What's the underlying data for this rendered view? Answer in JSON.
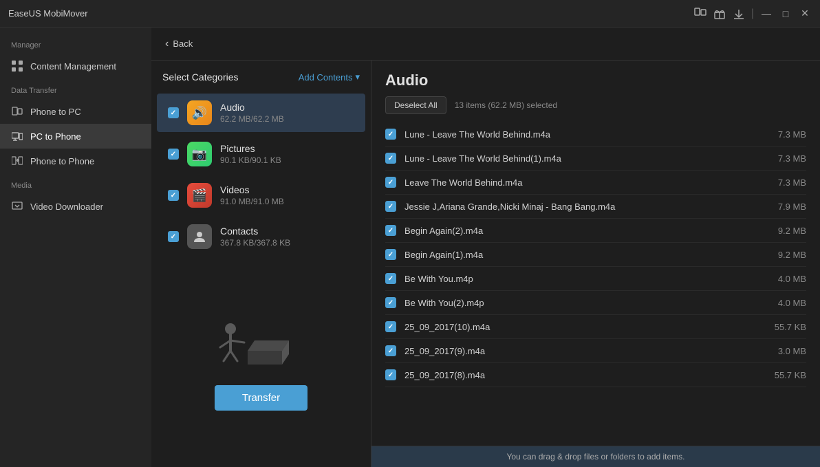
{
  "app": {
    "title": "EaseUS MobiMover"
  },
  "titlebar": {
    "icons": [
      "device-icon",
      "gift-icon",
      "download-icon"
    ],
    "controls": [
      "minimize",
      "maximize",
      "close"
    ]
  },
  "sidebar": {
    "manager_label": "Manager",
    "content_management_label": "Content Management",
    "data_transfer_label": "Data Transfer",
    "items": [
      {
        "id": "content-management",
        "label": "Content Management",
        "icon": "⊞"
      },
      {
        "id": "phone-to-pc",
        "label": "Phone to PC",
        "icon": "📱"
      },
      {
        "id": "pc-to-phone",
        "label": "PC to Phone",
        "icon": "💻",
        "active": true
      },
      {
        "id": "phone-to-phone",
        "label": "Phone to Phone",
        "icon": "📲"
      }
    ],
    "media_label": "Media",
    "media_items": [
      {
        "id": "video-downloader",
        "label": "Video Downloader",
        "icon": "▼"
      }
    ]
  },
  "back_button": "Back",
  "select_categories": {
    "title": "Select Categories",
    "add_contents_label": "Add Contents",
    "items": [
      {
        "id": "audio",
        "name": "Audio",
        "size": "62.2 MB/62.2 MB",
        "type": "audio",
        "checked": true
      },
      {
        "id": "pictures",
        "name": "Pictures",
        "size": "90.1 KB/90.1 KB",
        "type": "pictures",
        "checked": true
      },
      {
        "id": "videos",
        "name": "Videos",
        "size": "91.0 MB/91.0 MB",
        "type": "videos",
        "checked": true
      },
      {
        "id": "contacts",
        "name": "Contacts",
        "size": "367.8 KB/367.8 KB",
        "type": "contacts",
        "checked": true
      }
    ]
  },
  "transfer_button": "Transfer",
  "files_panel": {
    "title": "Audio",
    "deselect_all": "Deselect All",
    "selection_info": "13 items (62.2 MB) selected",
    "files": [
      {
        "name": "Lune - Leave The World Behind.m4a",
        "size": "7.3 MB",
        "checked": true
      },
      {
        "name": "Lune - Leave The World Behind(1).m4a",
        "size": "7.3 MB",
        "checked": true
      },
      {
        "name": "Leave The World Behind.m4a",
        "size": "7.3 MB",
        "checked": true
      },
      {
        "name": "Jessie J,Ariana Grande,Nicki Minaj - Bang Bang.m4a",
        "size": "7.9 MB",
        "checked": true
      },
      {
        "name": "Begin Again(2).m4a",
        "size": "9.2 MB",
        "checked": true
      },
      {
        "name": "Begin Again(1).m4a",
        "size": "9.2 MB",
        "checked": true
      },
      {
        "name": "Be With You.m4p",
        "size": "4.0 MB",
        "checked": true
      },
      {
        "name": "Be With You(2).m4p",
        "size": "4.0 MB",
        "checked": true
      },
      {
        "name": "25_09_2017(10).m4a",
        "size": "55.7 KB",
        "checked": true
      },
      {
        "name": "25_09_2017(9).m4a",
        "size": "3.0 MB",
        "checked": true
      },
      {
        "name": "25_09_2017(8).m4a",
        "size": "55.7 KB",
        "checked": true
      }
    ]
  },
  "drag_hint": "You can drag & drop files or folders to add items.",
  "colors": {
    "accent": "#4a9fd4",
    "bg_dark": "#1e1e1e",
    "bg_medium": "#252525",
    "bg_light": "#2a2a2a",
    "text_primary": "#e0e0e0",
    "text_secondary": "#888"
  }
}
